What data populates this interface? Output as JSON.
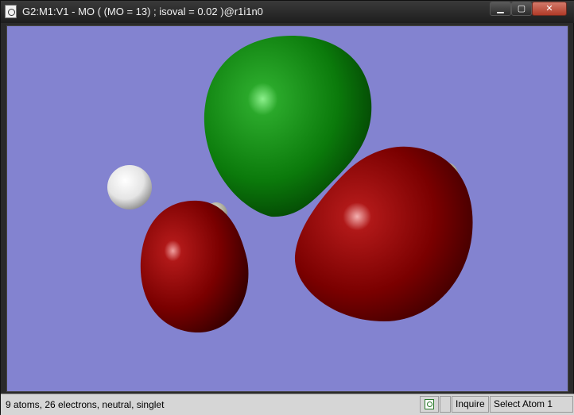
{
  "window": {
    "title": "G2:M1:V1 - MO ( (MO = 13) ; isoval = 0.02 )@r1i1n0"
  },
  "viewport": {
    "background_color": "#8383d0",
    "lobe_positive_color": "#0f8a0f",
    "lobe_negative_color": "#8a0000",
    "atom_color": "#f2f2f2"
  },
  "statusbar": {
    "info_text": "9 atoms, 26 electrons, neutral, singlet",
    "mode_label": "Inquire",
    "action_label": "Select Atom 1"
  },
  "icons": {
    "window_icon": "document-molecule-icon",
    "status_icon": "document-molecule-icon"
  }
}
